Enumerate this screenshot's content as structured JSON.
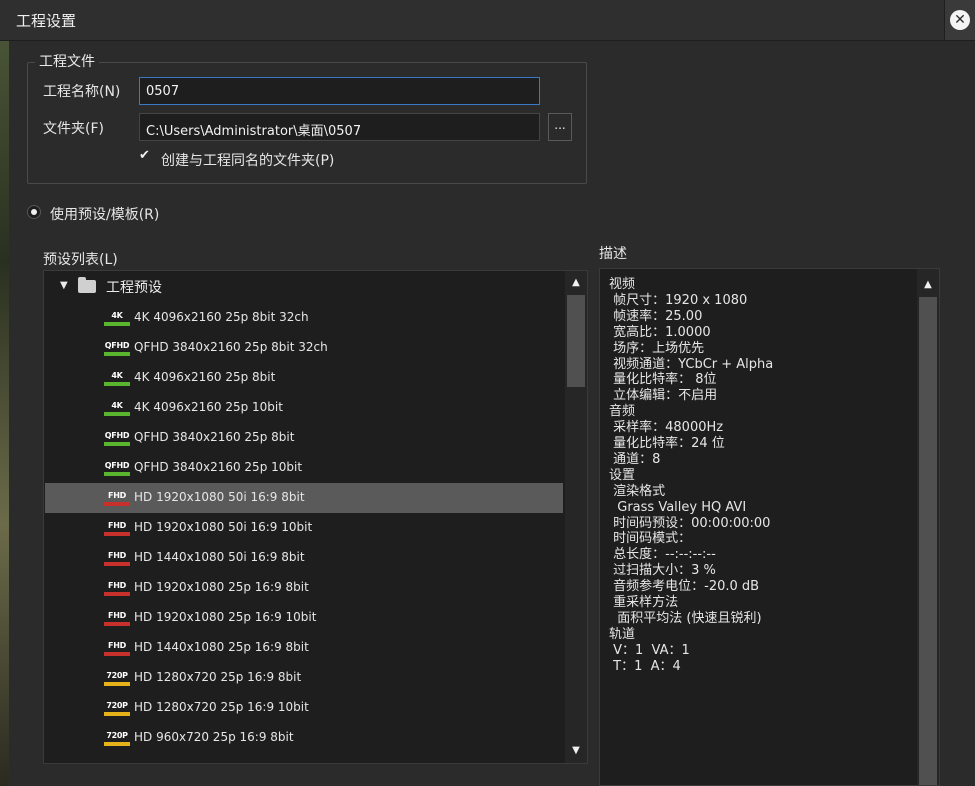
{
  "window": {
    "title": "工程设置",
    "close_label": "✕"
  },
  "project_file": {
    "group_label": "工程文件",
    "name_label": "工程名称(N)",
    "name_value": "0507",
    "folder_label": "文件夹(F)",
    "folder_value": "C:\\Users\\Administrator\\桌面\\0507",
    "browse_label": "...",
    "create_folder_checked": true,
    "create_folder_label": "创建与工程同名的文件夹(P)"
  },
  "use_preset": {
    "label": "使用预设/模板(R)",
    "selected": true
  },
  "preset_list": {
    "label": "预设列表(L)",
    "root": "工程预设",
    "items": [
      {
        "badge": "4K",
        "badge_color": "#5ab52e",
        "label": "4K 4096x2160 25p 8bit 32ch",
        "selected": false
      },
      {
        "badge": "QFHD",
        "badge_color": "#5ab52e",
        "label": "QFHD 3840x2160 25p 8bit 32ch",
        "selected": false
      },
      {
        "badge": "4K",
        "badge_color": "#5ab52e",
        "label": "4K 4096x2160 25p 8bit",
        "selected": false
      },
      {
        "badge": "4K",
        "badge_color": "#5ab52e",
        "label": "4K 4096x2160 25p 10bit",
        "selected": false
      },
      {
        "badge": "QFHD",
        "badge_color": "#5ab52e",
        "label": "QFHD 3840x2160 25p 8bit",
        "selected": false
      },
      {
        "badge": "QFHD",
        "badge_color": "#5ab52e",
        "label": "QFHD 3840x2160 25p 10bit",
        "selected": false
      },
      {
        "badge": "FHD",
        "badge_color": "#c8302c",
        "label": "HD 1920x1080 50i 16:9 8bit",
        "selected": true
      },
      {
        "badge": "FHD",
        "badge_color": "#c8302c",
        "label": "HD 1920x1080 50i 16:9 10bit",
        "selected": false
      },
      {
        "badge": "FHD",
        "badge_color": "#c8302c",
        "label": "HD 1440x1080 50i 16:9 8bit",
        "selected": false
      },
      {
        "badge": "FHD",
        "badge_color": "#c8302c",
        "label": "HD 1920x1080 25p 16:9 8bit",
        "selected": false
      },
      {
        "badge": "FHD",
        "badge_color": "#c8302c",
        "label": "HD 1920x1080 25p 16:9 10bit",
        "selected": false
      },
      {
        "badge": "FHD",
        "badge_color": "#c8302c",
        "label": "HD 1440x1080 25p 16:9 8bit",
        "selected": false
      },
      {
        "badge": "720P",
        "badge_color": "#e6b21a",
        "label": "HD 1280x720 25p 16:9 8bit",
        "selected": false
      },
      {
        "badge": "720P",
        "badge_color": "#e6b21a",
        "label": "HD 1280x720 25p 16:9 10bit",
        "selected": false
      },
      {
        "badge": "720P",
        "badge_color": "#e6b21a",
        "label": "HD 960x720 25p 16:9 8bit",
        "selected": false
      }
    ]
  },
  "description": {
    "label": "描述",
    "lines": [
      "视频",
      " 帧尺寸：1920 x 1080",
      " 帧速率：25.00",
      " 宽高比：1.0000",
      " 场序：上场优先",
      " 视频通道：YCbCr + Alpha",
      " 量化比特率： 8位",
      " 立体编辑：不启用",
      "音频",
      " 采样率：48000Hz",
      " 量化比特率：24 位",
      " 通道：8",
      "设置",
      " 渲染格式",
      "  Grass Valley HQ AVI",
      " 时间码预设：00:00:00:00",
      " 时间码模式：",
      " 总长度：--:--:--:--",
      " 过扫描大小：3 %",
      " 音频参考电位：-20.0 dB",
      " 重采样方法",
      "  面积平均法 (快速且锐利)",
      "轨道",
      " V：1  VA：1",
      " T：1  A：4"
    ]
  },
  "scroll": {
    "up_arrow": "▲",
    "down_arrow": "▼"
  }
}
